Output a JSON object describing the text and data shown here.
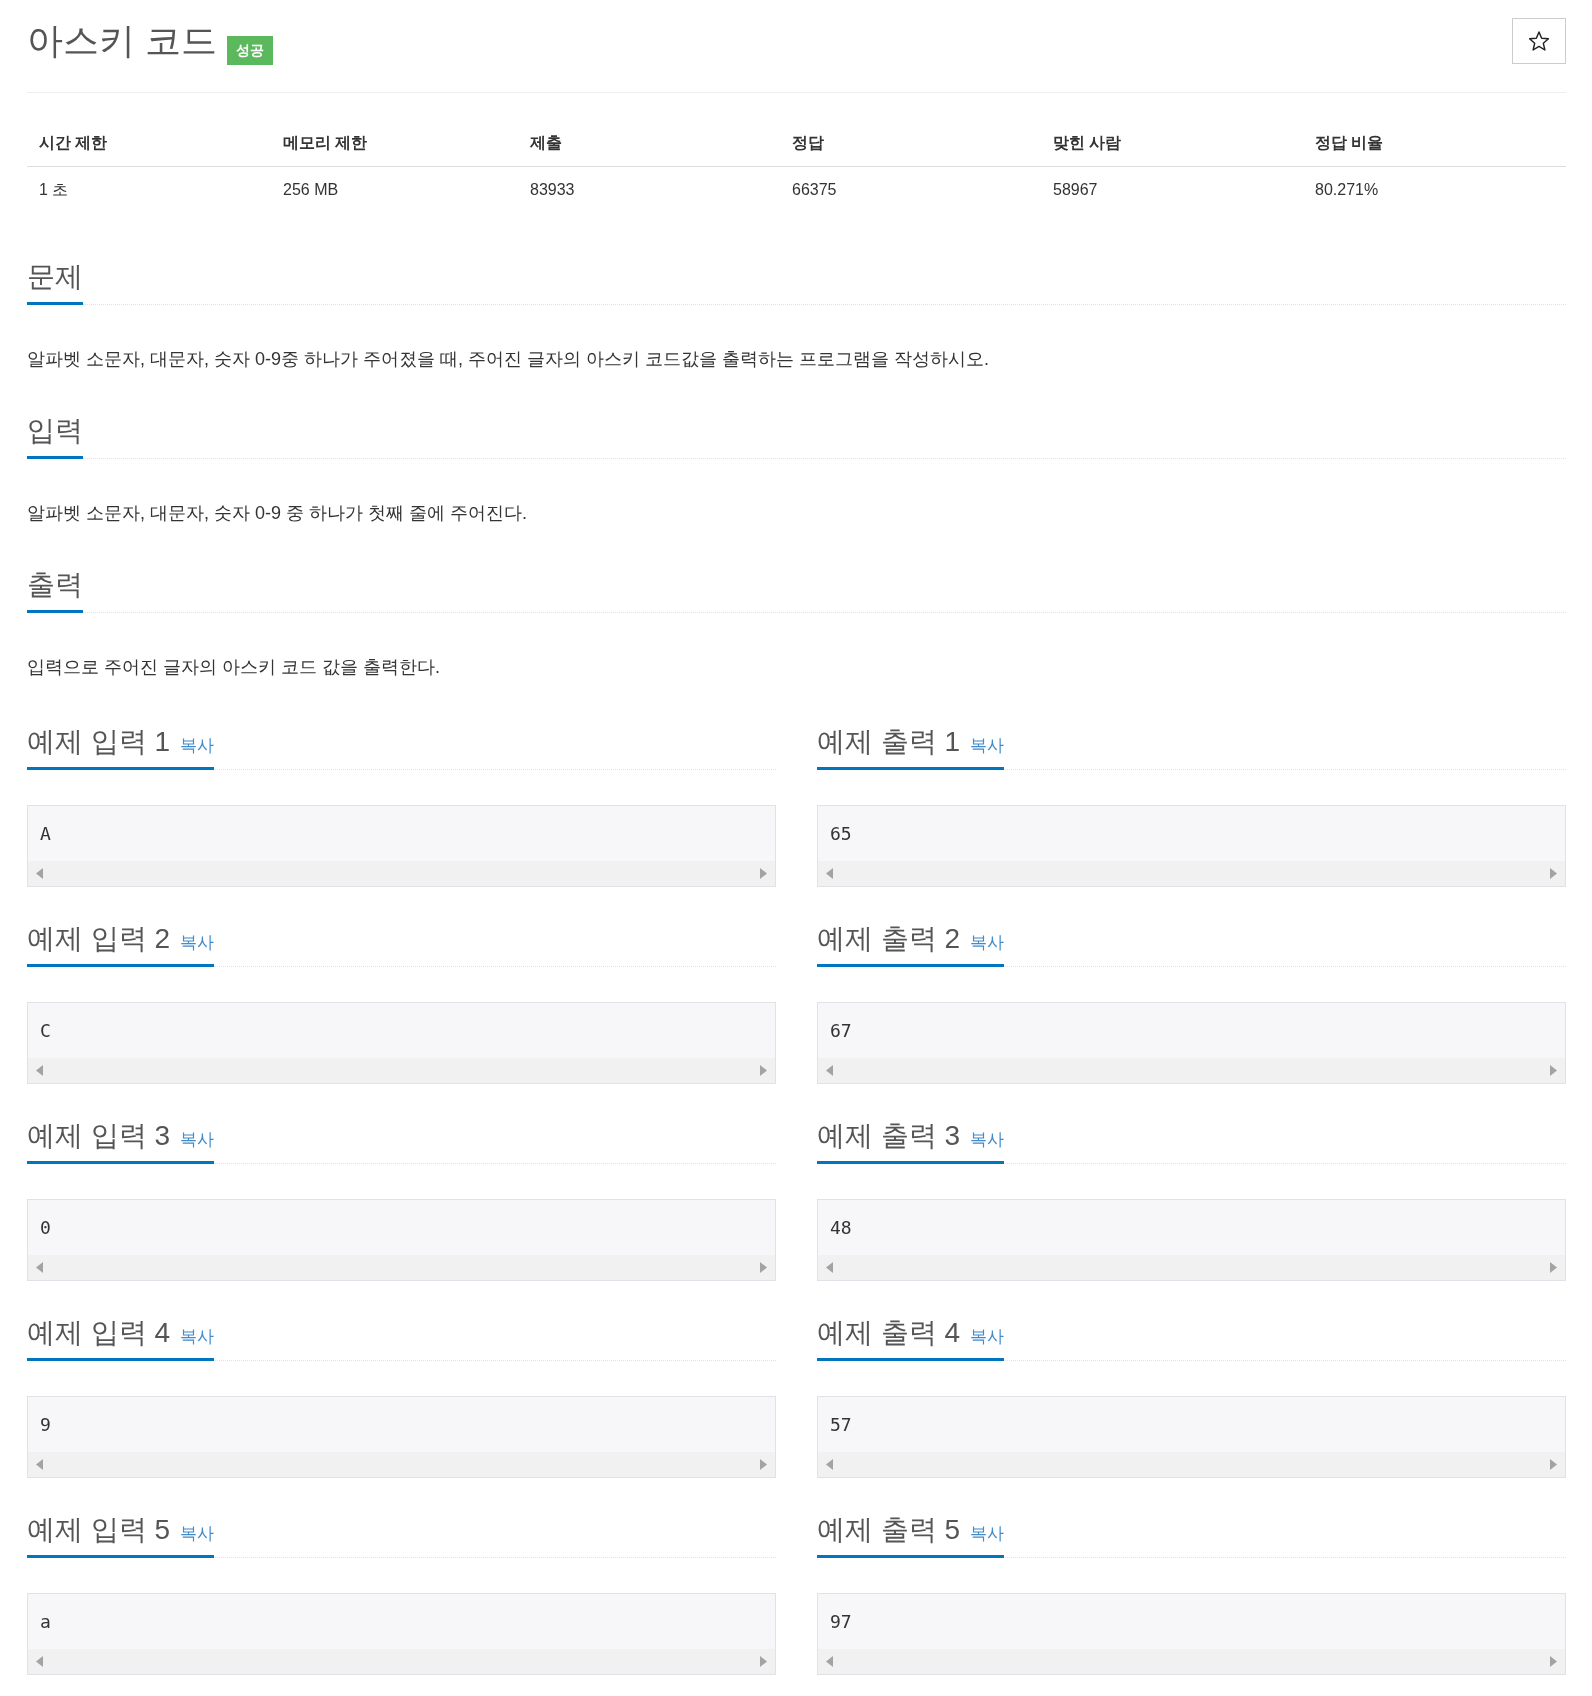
{
  "header": {
    "title": "아스키 코드",
    "badge": "성공"
  },
  "star_button": {
    "starred": false
  },
  "stats": {
    "columns": [
      "시간 제한",
      "메모리 제한",
      "제출",
      "정답",
      "맞힌 사람",
      "정답 비율"
    ],
    "values": [
      "1 초",
      "256 MB",
      "83933",
      "66375",
      "58967",
      "80.271%"
    ]
  },
  "sections": [
    {
      "heading": "문제",
      "text": "알파벳 소문자, 대문자, 숫자 0-9중 하나가 주어졌을 때, 주어진 글자의 아스키 코드값을 출력하는 프로그램을 작성하시오."
    },
    {
      "heading": "입력",
      "text": "알파벳 소문자, 대문자, 숫자 0-9 중 하나가 첫째 줄에 주어진다."
    },
    {
      "heading": "출력",
      "text": "입력으로 주어진 글자의 아스키 코드 값을 출력한다."
    }
  ],
  "samples": [
    {
      "input": {
        "heading": "예제 입력 1",
        "copy": "복사",
        "content": "A"
      },
      "output": {
        "heading": "예제 출력 1",
        "copy": "복사",
        "content": "65"
      }
    },
    {
      "input": {
        "heading": "예제 입력 2",
        "copy": "복사",
        "content": "C"
      },
      "output": {
        "heading": "예제 출력 2",
        "copy": "복사",
        "content": "67"
      }
    },
    {
      "input": {
        "heading": "예제 입력 3",
        "copy": "복사",
        "content": "0"
      },
      "output": {
        "heading": "예제 출력 3",
        "copy": "복사",
        "content": "48"
      }
    },
    {
      "input": {
        "heading": "예제 입력 4",
        "copy": "복사",
        "content": "9"
      },
      "output": {
        "heading": "예제 출력 4",
        "copy": "복사",
        "content": "57"
      }
    },
    {
      "input": {
        "heading": "예제 입력 5",
        "copy": "복사",
        "content": "a"
      },
      "output": {
        "heading": "예제 출력 5",
        "copy": "복사",
        "content": "97"
      }
    }
  ]
}
